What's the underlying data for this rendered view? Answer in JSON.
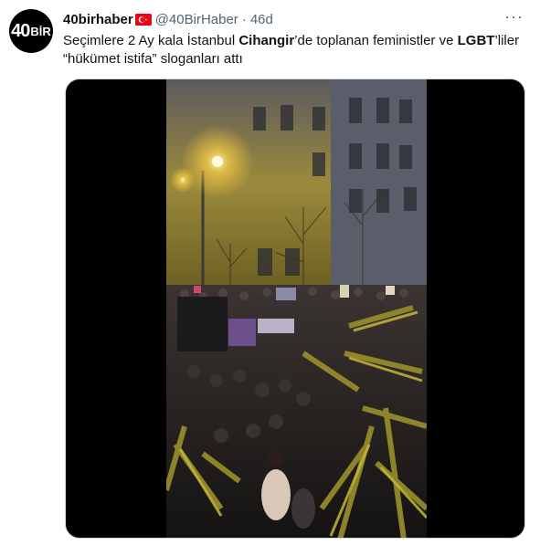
{
  "author": {
    "display_name": "40birhaber",
    "handle": "@40BirHaber",
    "separator": "·",
    "timestamp": "46d",
    "avatar_text_num": "40",
    "avatar_text_word": "BİR"
  },
  "tweet": {
    "text_part1": "Seçimlere 2 Ay kala İstanbul ",
    "text_bold1": "Cihangir",
    "text_part2": "’de toplanan feministler ve ",
    "text_bold2": "LGBT",
    "text_part3": "’liler “hükümet istifa” sloganları attı"
  },
  "more_label": "···",
  "icons": {
    "flag": "turkey-flag-icon",
    "more": "more-options-icon"
  },
  "colors": {
    "text_primary": "#0f1419",
    "text_secondary": "#536471",
    "media_bg": "#000000"
  }
}
